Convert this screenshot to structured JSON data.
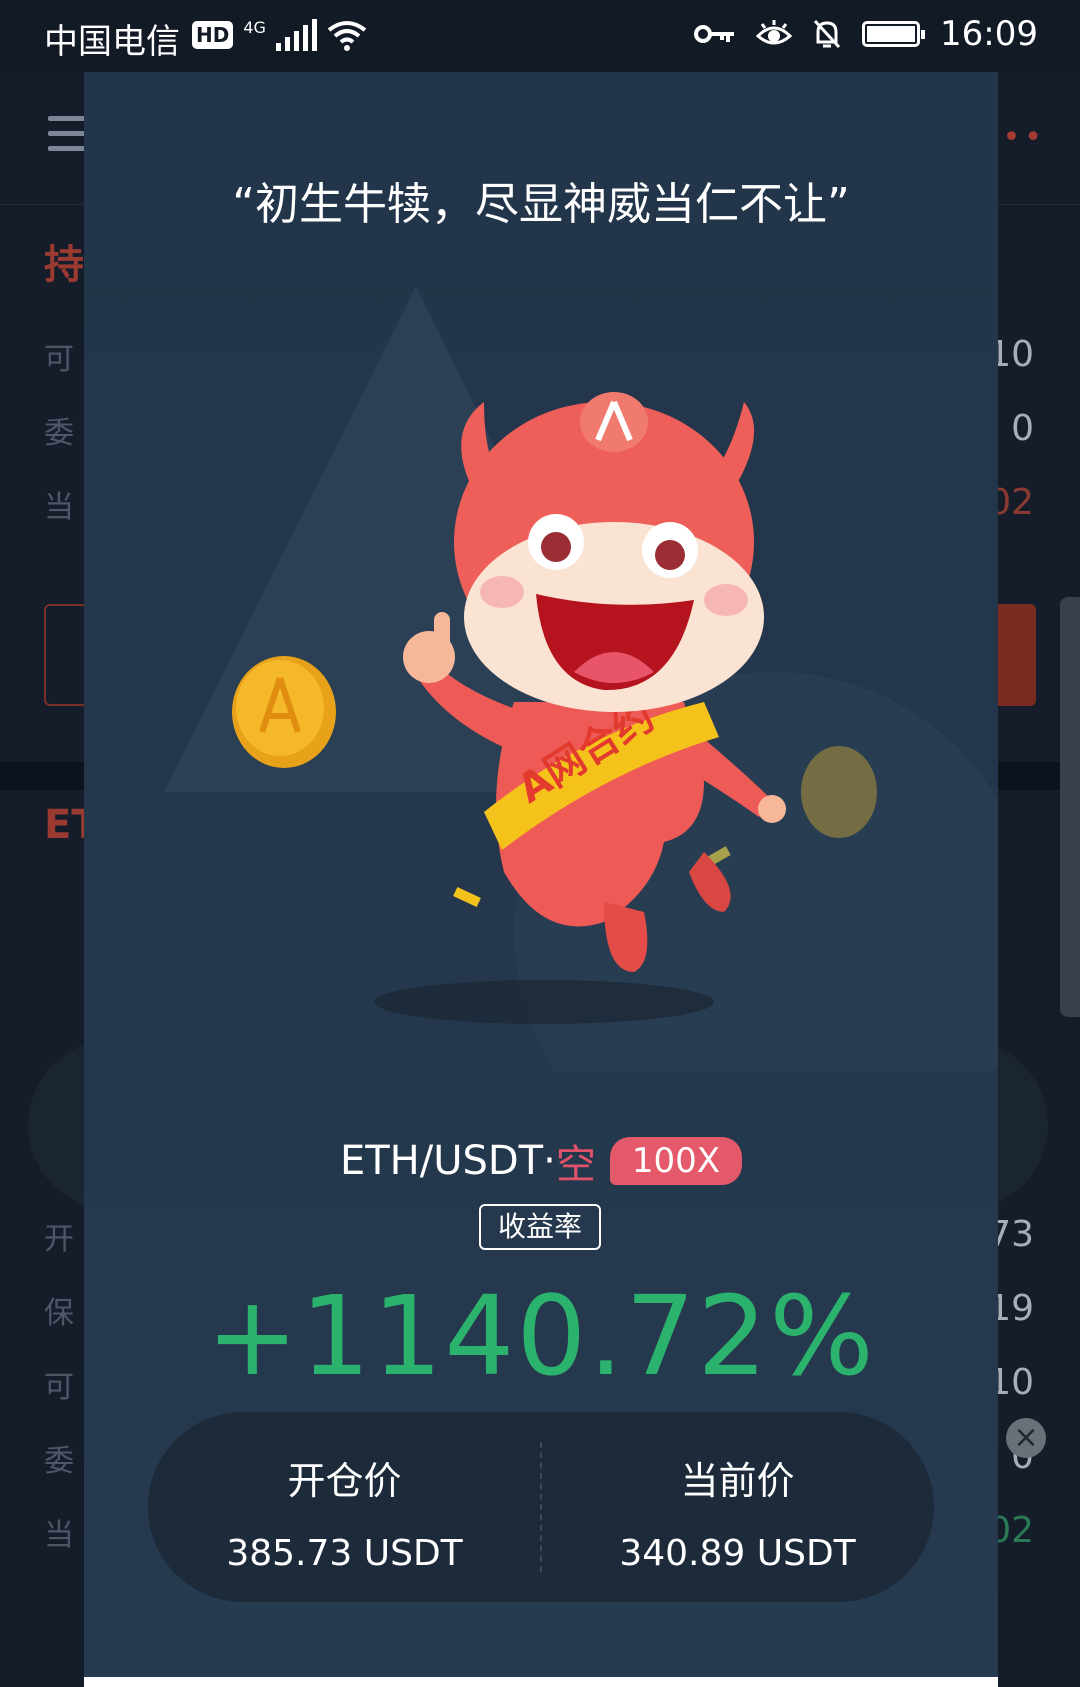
{
  "status_bar": {
    "carrier": "中国电信",
    "hd": "HD",
    "network": "4G",
    "time": "16:09"
  },
  "background_app": {
    "section_title": "持",
    "section_title_2": "ET",
    "rows_top": [
      {
        "label": "可",
        "value": "10"
      },
      {
        "label": "委",
        "value": "0"
      },
      {
        "label": "当",
        "value": "02"
      }
    ],
    "rows_bottom": [
      {
        "label": "开",
        "value": "73"
      },
      {
        "label": "保",
        "value": "19"
      },
      {
        "label": "可",
        "value": "10"
      },
      {
        "label": "委",
        "value": "0"
      },
      {
        "label": "当",
        "value": "02"
      }
    ]
  },
  "modal": {
    "quote": "“初生牛犊，尽显神威当仁不让”",
    "mascot_sash": "A网合约",
    "pair": "ETH/USDT",
    "separator": "·",
    "direction": "空",
    "leverage": "100X",
    "yield_label": "收益率",
    "yield_value": "+1140.72%",
    "open_price_label": "开仓价",
    "open_price_value": "385.73 USDT",
    "current_price_label": "当前价",
    "current_price_value": "340.89 USDT"
  },
  "colors": {
    "modal_bg": "#24374c",
    "profit_green": "#2bb36e",
    "short_red": "#e0536a",
    "leverage_badge": "#e55a6b"
  }
}
